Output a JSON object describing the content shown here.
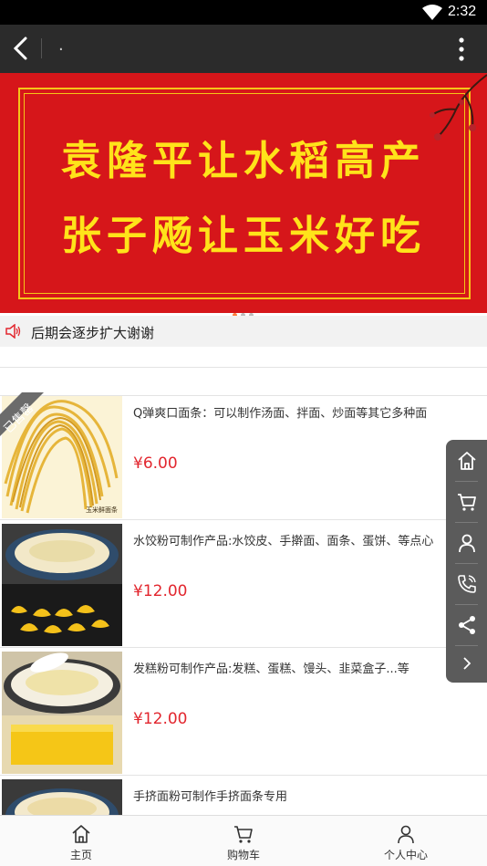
{
  "status_bar": {
    "time": "2:32"
  },
  "app_bar": {
    "title": "."
  },
  "banner": {
    "line1": "袁隆平让水稻高产",
    "line2": "张子飏让玉米好吃",
    "dots": 3,
    "active_dot": 0
  },
  "notice": {
    "text": "后期会逐步扩大谢谢"
  },
  "products": [
    {
      "name": "Q弹爽口面条：可以制作汤面、拌面、炒面等其它多种面",
      "price": "¥6.00",
      "badge": "已售罄",
      "thumb_caption": "玉米鲜面条"
    },
    {
      "name": "水饺粉可制作产品:水饺皮、手擀面、面条、蛋饼、等点心",
      "price": "¥12.00"
    },
    {
      "name": "发糕粉可制作产品:发糕、蛋糕、馒头、韭菜盒子...等",
      "price": "¥12.00"
    },
    {
      "name": "手挤面粉可制作手挤面条专用",
      "price": ""
    }
  ],
  "sidebar": {
    "items": [
      "home-icon",
      "cart-icon",
      "user-icon",
      "phone-icon",
      "share-icon",
      "chevron-right-icon"
    ]
  },
  "tab_bar": {
    "tabs": [
      {
        "label": "主页",
        "icon": "home-icon"
      },
      {
        "label": "购物车",
        "icon": "cart-icon"
      },
      {
        "label": "个人中心",
        "icon": "user-icon"
      }
    ]
  },
  "colors": {
    "accent_red": "#d6161a",
    "price_red": "#e2262e",
    "banner_text": "#ffe31a"
  }
}
